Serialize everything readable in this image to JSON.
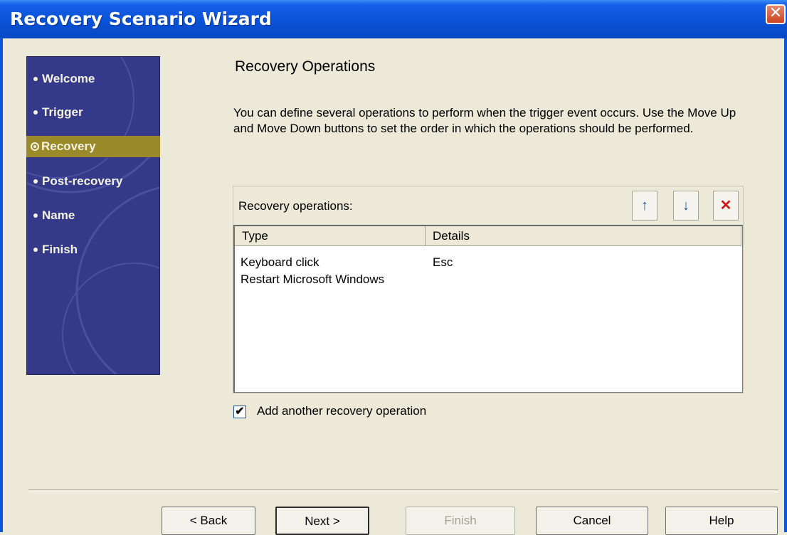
{
  "window": {
    "title": "Recovery Scenario Wizard",
    "close_glyph": "✕"
  },
  "sidebar": {
    "items": [
      {
        "label": "Welcome",
        "active": false
      },
      {
        "label": "Trigger",
        "active": false
      },
      {
        "label": "Recovery",
        "active": true
      },
      {
        "label": "Post-recovery",
        "active": false
      },
      {
        "label": "Name",
        "active": false
      },
      {
        "label": "Finish",
        "active": false
      }
    ]
  },
  "page": {
    "heading": "Recovery Operations",
    "description": "You can define several operations to perform when the trigger event occurs. Use the Move Up and Move Down buttons to set the order in which the operations should be performed."
  },
  "operations": {
    "label": "Recovery operations:",
    "toolbar": {
      "move_up_glyph": "↑",
      "move_down_glyph": "↓",
      "delete_glyph": "✕",
      "move_up_color": "#1a5a9a",
      "move_down_color": "#1a5a9a",
      "delete_color": "#d21414"
    },
    "columns": [
      "Type",
      "Details"
    ],
    "rows": [
      {
        "type": "Keyboard click",
        "details": "Esc"
      },
      {
        "type": "Restart Microsoft Windows",
        "details": ""
      }
    ]
  },
  "add_another": {
    "label": "Add another recovery operation",
    "checked": true,
    "check_glyph": "✔"
  },
  "buttons": {
    "back": "< Back",
    "next": "Next >",
    "finish": "Finish",
    "cancel": "Cancel",
    "help": "Help"
  },
  "colors": {
    "titlebar": "#0a52d6",
    "sidebar": "#34398a",
    "sidebar_active": "#9a8a2a",
    "dialog_bg": "#ece9d8"
  }
}
